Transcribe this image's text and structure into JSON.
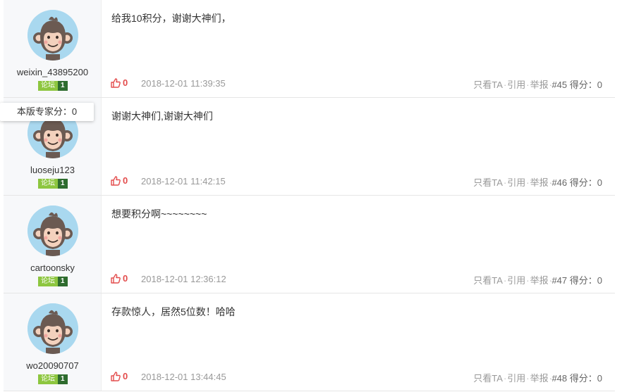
{
  "posts": [
    {
      "username": "weixin_43895200",
      "level_label": "论坛",
      "level_num": "1",
      "content": "给我10积分，谢谢大神们，",
      "likes": "0",
      "time": "2018-12-01 11:39:35",
      "action_only": "只看TA",
      "action_quote": "引用",
      "action_report": "举报",
      "floor": "#45 得分：0"
    },
    {
      "username": "luoseju123",
      "level_label": "论坛",
      "level_num": "1",
      "content": "谢谢大神们,谢谢大神们",
      "likes": "0",
      "time": "2018-12-01 11:42:15",
      "action_only": "只看TA",
      "action_quote": "引用",
      "action_report": "举报",
      "floor": "#46 得分：0"
    },
    {
      "username": "cartoonsky",
      "level_label": "论坛",
      "level_num": "1",
      "content": "想要积分啊~~~~~~~~",
      "likes": "0",
      "time": "2018-12-01 12:36:12",
      "action_only": "只看TA",
      "action_quote": "引用",
      "action_report": "举报",
      "floor": "#47 得分：0"
    },
    {
      "username": "wo20090707",
      "level_label": "论坛",
      "level_num": "1",
      "content": "存款惊人，居然5位数！哈哈",
      "likes": "0",
      "time": "2018-12-01 13:44:45",
      "action_only": "只看TA",
      "action_quote": "引用",
      "action_report": "举报",
      "floor": "#48 得分：0"
    }
  ],
  "tooltip": {
    "text": "本版专家分：0"
  },
  "icons": {
    "avatar": "monkey-avatar-icon",
    "like": "thumbs-up-icon"
  },
  "colors": {
    "like": "#e34c4c",
    "level_badge": "#8dc63f",
    "level_num": "#2e6c2e",
    "avatar_bg": "#a9d8ef"
  }
}
